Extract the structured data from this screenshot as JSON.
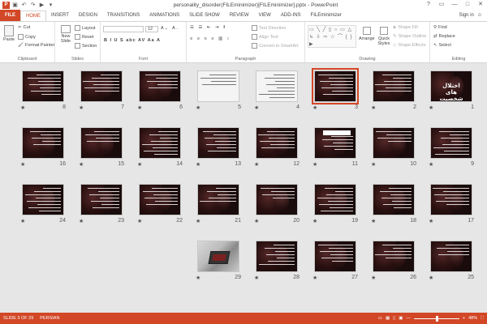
{
  "window": {
    "title": "personality_disorder(FILEminimizer)[FILEminimizer].pptx - PowerPoint",
    "controls": [
      "?",
      "▭",
      "—",
      "□",
      "✕"
    ]
  },
  "qat": {
    "app_icon": "P",
    "icons": [
      "save-icon",
      "undo-icon",
      "redo-icon",
      "start-from-beginning-icon",
      "customize-qat-icon"
    ]
  },
  "tabs": [
    "FILE",
    "HOME",
    "INSERT",
    "DESIGN",
    "TRANSITIONS",
    "ANIMATIONS",
    "SLIDE SHOW",
    "REVIEW",
    "VIEW",
    "ADD-INS",
    "FILEminimizer"
  ],
  "active_tab": "HOME",
  "account": {
    "label": "Sign in",
    "icon": "smiley-icon"
  },
  "ribbon": {
    "clipboard": {
      "label": "Clipboard",
      "paste": "Paste",
      "cut": "Cut",
      "copy": "Copy",
      "format_painter": "Format Painter"
    },
    "slides": {
      "label": "Slides",
      "new_slide": "New Slide",
      "layout": "Layout",
      "reset": "Reset",
      "section": "Section"
    },
    "font": {
      "label": "Font",
      "size": "12",
      "buttons": "B  I  U  S  abc  AV  Aa  A"
    },
    "paragraph": {
      "label": "Paragraph",
      "text_direction": "Text Direction",
      "align_text": "Align Text",
      "convert_smartart": "Convert to SmartArt"
    },
    "drawing": {
      "label": "Drawing",
      "arrange": "Arrange",
      "quick_styles": "Quick Styles",
      "shape_fill": "Shape Fill",
      "shape_outline": "Shape Outline",
      "shape_effects": "Shape Effects",
      "shapes_glyphs": "▭ ╲ ╱ ▯ ○ ▭ △ ↳ ⇩ ⇨ ☆ ⌒ { } ▶"
    },
    "editing": {
      "label": "Editing",
      "find": "Find",
      "replace": "Replace",
      "select": "Select"
    }
  },
  "slides": [
    {
      "n": "1",
      "kind": "title",
      "title": "اختلال های شخصیت"
    },
    {
      "n": "2",
      "kind": "dark"
    },
    {
      "n": "3",
      "kind": "dark",
      "selected": true
    },
    {
      "n": "4",
      "kind": "light"
    },
    {
      "n": "5",
      "kind": "light"
    },
    {
      "n": "6",
      "kind": "dark"
    },
    {
      "n": "7",
      "kind": "dark"
    },
    {
      "n": "8",
      "kind": "dark"
    },
    {
      "n": "9",
      "kind": "dark"
    },
    {
      "n": "10",
      "kind": "dark"
    },
    {
      "n": "11",
      "kind": "banner"
    },
    {
      "n": "12",
      "kind": "dark"
    },
    {
      "n": "13",
      "kind": "dark"
    },
    {
      "n": "14",
      "kind": "dark"
    },
    {
      "n": "15",
      "kind": "dark"
    },
    {
      "n": "16",
      "kind": "dark"
    },
    {
      "n": "17",
      "kind": "dark"
    },
    {
      "n": "18",
      "kind": "dark"
    },
    {
      "n": "19",
      "kind": "dark"
    },
    {
      "n": "20",
      "kind": "dark"
    },
    {
      "n": "21",
      "kind": "dark"
    },
    {
      "n": "22",
      "kind": "dark"
    },
    {
      "n": "23",
      "kind": "dark"
    },
    {
      "n": "24",
      "kind": "dark"
    },
    {
      "n": "25",
      "kind": "dark"
    },
    {
      "n": "26",
      "kind": "dark"
    },
    {
      "n": "27",
      "kind": "dark"
    },
    {
      "n": "28",
      "kind": "dark"
    },
    {
      "n": "29",
      "kind": "photo"
    }
  ],
  "status": {
    "slide_info": "SLIDE 3 OF 29",
    "language": "PERSIAN",
    "zoom": "48%",
    "zoom_level_percent": 48,
    "view_icons": [
      "normal-view-icon",
      "slide-sorter-icon",
      "reading-view-icon",
      "slide-show-icon"
    ]
  },
  "colors": {
    "accent": "#d24726",
    "workspace": "#e6e6e6",
    "slide_bg": "#1a0c0c"
  }
}
